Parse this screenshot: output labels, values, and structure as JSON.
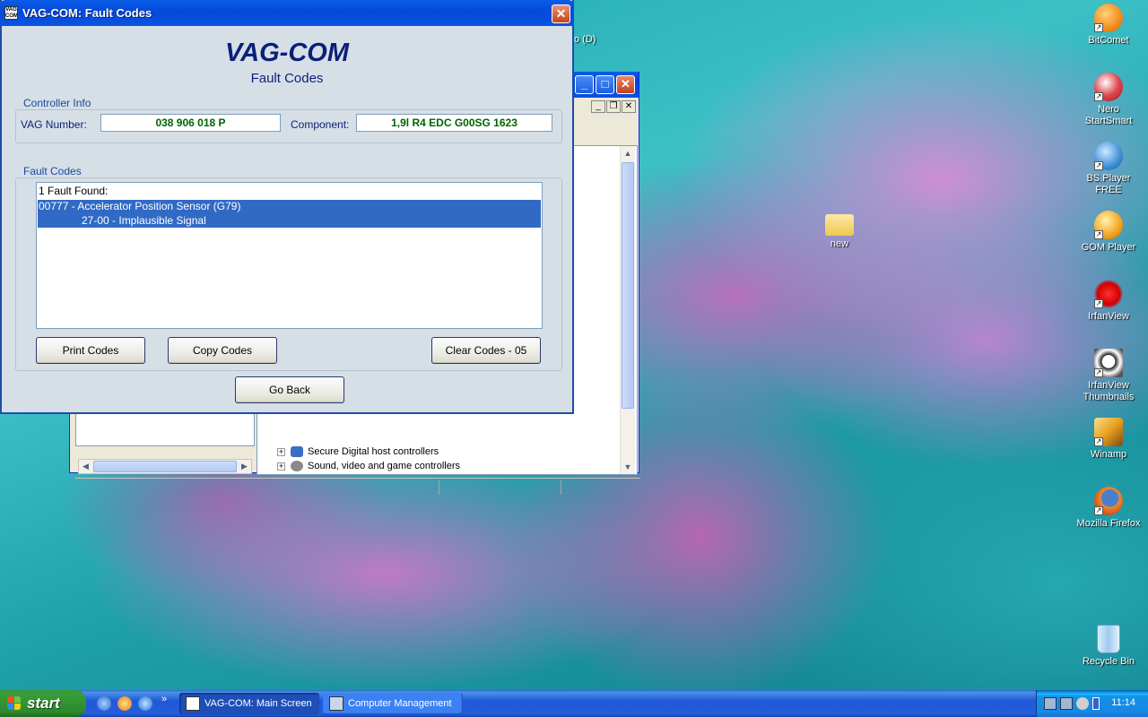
{
  "desktop": {
    "partial_label": "o (D)",
    "icons": [
      {
        "label": "BitComet",
        "color": "#f28c1e"
      },
      {
        "label": "Nero StartSmart",
        "color": "#d9262b"
      },
      {
        "label": "BS.Player FREE",
        "color": "#3b8fd8"
      },
      {
        "label": "GOM Player",
        "color": "#f2a31e"
      },
      {
        "label": "IrfanView",
        "color": "#e01a1a"
      },
      {
        "label": "IrfanView Thumbnails",
        "color": "#333333"
      },
      {
        "label": "Winamp",
        "color": "#e8a020"
      },
      {
        "label": "Mozilla Firefox",
        "color": "#e46b1f"
      },
      {
        "label": "Recycle Bin",
        "color": "#6fb4e8"
      },
      {
        "label": "new",
        "color": "#f5d060"
      }
    ]
  },
  "computer_management": {
    "tree_rows": [
      {
        "label": "Secure Digital host controllers"
      },
      {
        "label": "Sound, video and game controllers"
      }
    ]
  },
  "vag_window": {
    "title": "VAG-COM: Fault Codes",
    "icon_text": "VAG COM",
    "heading": "VAG-COM",
    "subheading": "Fault Codes",
    "controller_info": {
      "group_label": "Controller Info",
      "vag_number_label": "VAG Number:",
      "vag_number_value": "038 906 018 P",
      "component_label": "Component:",
      "component_value": "1,9l R4 EDC  G00SG  1623"
    },
    "fault_codes": {
      "group_label": "Fault Codes",
      "summary": "1 Fault Found:",
      "fault_code": "00777 - Accelerator Position Sensor (G79)",
      "fault_detail": "27-00 - Implausible Signal"
    },
    "buttons": {
      "print": "Print Codes",
      "copy": "Copy Codes",
      "clear": "Clear Codes - 05",
      "go_back": "Go Back"
    }
  },
  "taskbar": {
    "start_label": "start",
    "tasks": [
      {
        "label": "VAG-COM: Main Screen",
        "active": true
      },
      {
        "label": "Computer Management",
        "active": false
      }
    ],
    "clock": "11:14"
  },
  "colors": {
    "title_blue": "#0a5ce8",
    "heading_navy": "#0b1f7a",
    "value_green": "#006400",
    "selection_blue": "#316ac5"
  }
}
